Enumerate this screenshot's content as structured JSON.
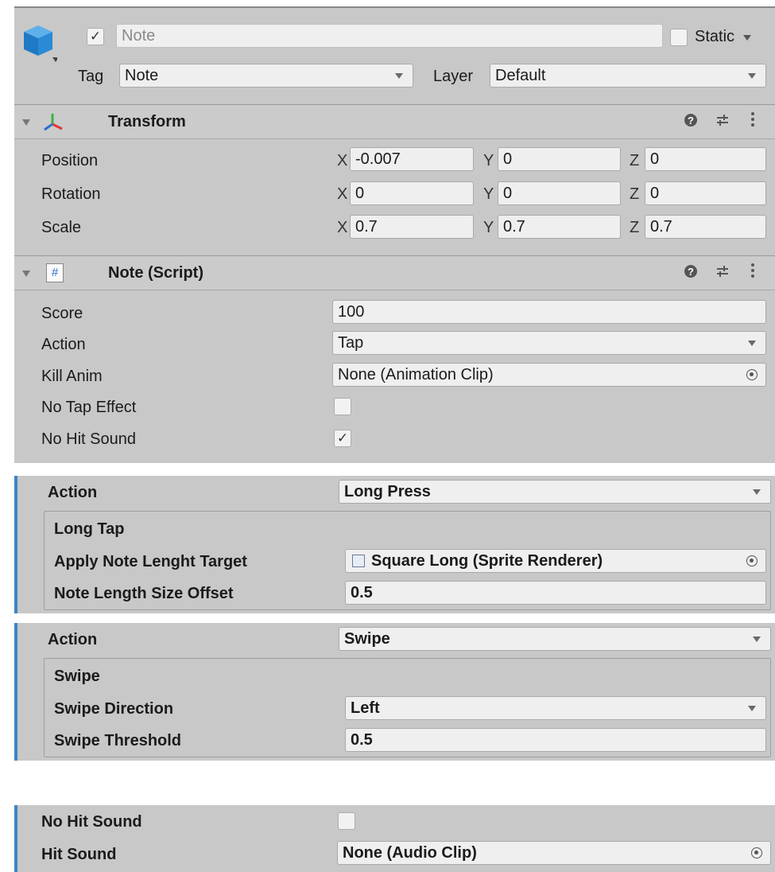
{
  "header": {
    "active_checked": true,
    "name": "Note",
    "static_label": "Static",
    "tag_label": "Tag",
    "tag_value": "Note",
    "layer_label": "Layer",
    "layer_value": "Default"
  },
  "transform": {
    "title": "Transform",
    "rows": [
      {
        "label": "Position",
        "x": "-0.007",
        "y": "0",
        "z": "0"
      },
      {
        "label": "Rotation",
        "x": "0",
        "y": "0",
        "z": "0"
      },
      {
        "label": "Scale",
        "x": "0.7",
        "y": "0.7",
        "z": "0.7"
      }
    ],
    "axis_x": "X",
    "axis_y": "Y",
    "axis_z": "Z"
  },
  "note_script": {
    "title": "Note (Script)",
    "score_label": "Score",
    "score_value": "100",
    "action_label": "Action",
    "action_value": "Tap",
    "kill_anim_label": "Kill Anim",
    "kill_anim_value": "None (Animation Clip)",
    "no_tap_effect_label": "No Tap Effect",
    "no_tap_effect_checked": false,
    "no_hit_sound_label": "No Hit Sound",
    "no_hit_sound_checked": true
  },
  "long_press_panel": {
    "action_label": "Action",
    "action_value": "Long Press",
    "section_title": "Long Tap",
    "apply_label": "Apply Note Lenght Target",
    "apply_value": "Square Long (Sprite Renderer)",
    "offset_label": "Note Length Size Offset",
    "offset_value": "0.5"
  },
  "swipe_panel": {
    "action_label": "Action",
    "action_value": "Swipe",
    "section_title": "Swipe",
    "direction_label": "Swipe Direction",
    "direction_value": "Left",
    "threshold_label": "Swipe Threshold",
    "threshold_value": "0.5"
  },
  "sound_panel": {
    "no_hit_sound_label": "No Hit Sound",
    "no_hit_sound_checked": false,
    "hit_sound_label": "Hit Sound",
    "hit_sound_value": "None (Audio Clip)"
  },
  "glyphs": {
    "check": "✓",
    "help": "❓",
    "settings": "⇌",
    "more": "⋮"
  }
}
